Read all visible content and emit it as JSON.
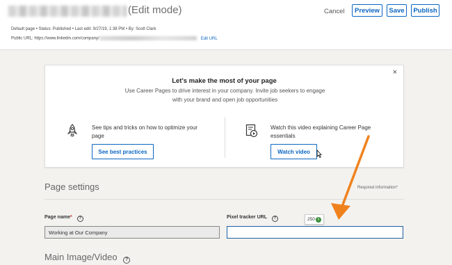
{
  "header": {
    "title_suffix": "(Edit mode)",
    "cancel_label": "Cancel",
    "preview_label": "Preview",
    "save_label": "Save",
    "publish_label": "Publish"
  },
  "meta": {
    "line1": "Default page  •  Status: Published  •  Last edit: 9/27/19, 1:38 PM  •  By: Scott Clark",
    "public_url_prefix": "Public URL: https://www.linkedin.com/company/",
    "edit_url_label": "Edit URL"
  },
  "banner": {
    "close_symbol": "×",
    "title": "Let's make the most of your page",
    "subtitle": "Use Career Pages to drive interest in your company. Invite job seekers to engage with your brand and open job opportunities",
    "tip_left_text": "See tips and tricks on how to optimize your page",
    "tip_left_button": "See best practices",
    "tip_right_text": "Watch this video explaining Career Page essentials",
    "tip_right_button": "Watch video"
  },
  "settings": {
    "title": "Page settings",
    "required_note": "Required information*",
    "page_name_label": "Page name",
    "page_name_required": "*",
    "page_name_value": "Working at Our Company",
    "pixel_label": "Pixel tracker URL",
    "pixel_value": "",
    "char_count": "250",
    "main_media_title": "Main Image/Video"
  },
  "colors": {
    "accent": "#0a66c2",
    "annotation_arrow": "#f0821e",
    "counter_ok": "#3a8e3a"
  }
}
